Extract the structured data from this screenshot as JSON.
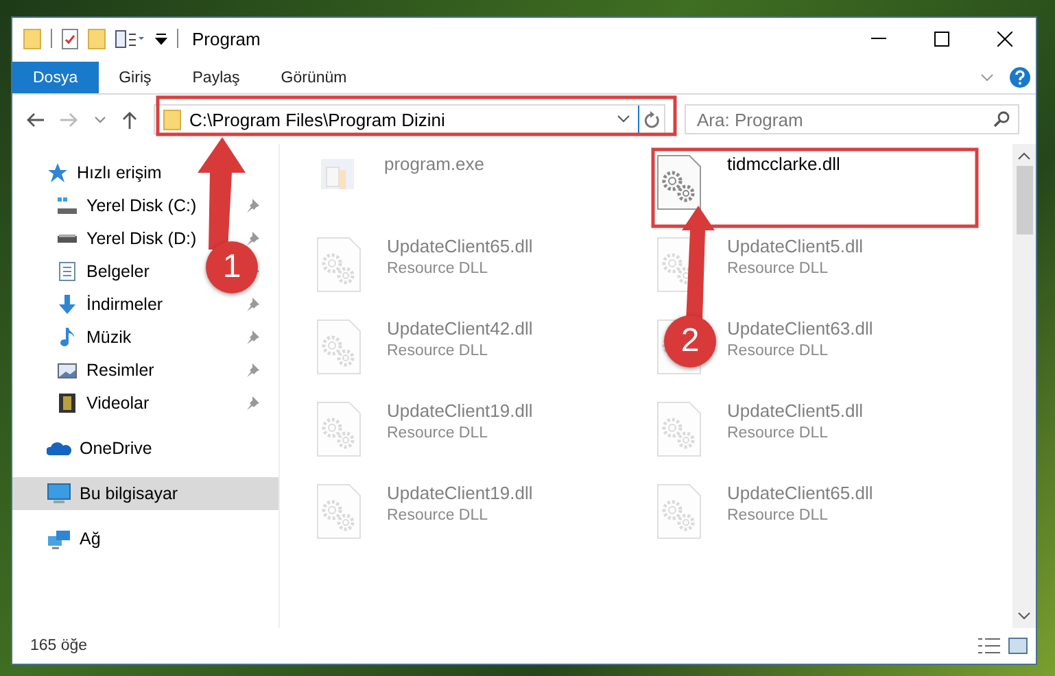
{
  "window": {
    "title": "Program"
  },
  "ribbon": {
    "tabs": [
      {
        "label": "Dosya",
        "selected": true
      },
      {
        "label": "Giriş",
        "selected": false
      },
      {
        "label": "Paylaş",
        "selected": false
      },
      {
        "label": "Görünüm",
        "selected": false
      }
    ]
  },
  "address_bar": {
    "path": "C:\\Program Files\\Program Dizini"
  },
  "search": {
    "placeholder": "Ara: Program"
  },
  "sidebar": {
    "items": [
      {
        "label": "Hızlı erişim",
        "kind": "star",
        "selected": false,
        "children": [
          {
            "label": "Yerel Disk (C:)",
            "kind": "drive-c",
            "pinned": true,
            "selected": false
          },
          {
            "label": "Yerel Disk (D:)",
            "kind": "drive",
            "pinned": true,
            "selected": false
          },
          {
            "label": "Belgeler",
            "kind": "document",
            "pinned": true,
            "selected": false
          },
          {
            "label": "İndirmeler",
            "kind": "download",
            "pinned": true,
            "selected": false
          },
          {
            "label": "Müzik",
            "kind": "music",
            "pinned": true,
            "selected": false
          },
          {
            "label": "Resimler",
            "kind": "picture",
            "pinned": true,
            "selected": false
          },
          {
            "label": "Videolar",
            "kind": "video",
            "pinned": true,
            "selected": false
          }
        ]
      },
      {
        "label": "OneDrive",
        "kind": "cloud",
        "selected": false
      },
      {
        "label": "Bu bilgisayar",
        "kind": "computer",
        "selected": true
      },
      {
        "label": "Ağ",
        "kind": "network",
        "selected": false
      }
    ]
  },
  "files": [
    {
      "name": "program.exe",
      "kind": "exe",
      "faded": true
    },
    {
      "name": "tidmcclarke.dll",
      "kind": "dll",
      "faded": false
    },
    {
      "name": "UpdateClient65.dll",
      "type": "Resource DLL",
      "kind": "dll",
      "faded": true
    },
    {
      "name": "UpdateClient5.dll",
      "type": "Resource DLL",
      "kind": "dll",
      "faded": true
    },
    {
      "name": "UpdateClient42.dll",
      "type": "Resource DLL",
      "kind": "dll",
      "faded": true
    },
    {
      "name": "UpdateClient63.dll",
      "type": "Resource DLL",
      "kind": "dll",
      "faded": true
    },
    {
      "name": "UpdateClient19.dll",
      "type": "Resource DLL",
      "kind": "dll",
      "faded": true
    },
    {
      "name": "UpdateClient5.dll",
      "type": "Resource DLL",
      "kind": "dll",
      "faded": true
    },
    {
      "name": "UpdateClient19.dll",
      "type": "Resource DLL",
      "kind": "dll",
      "faded": true
    },
    {
      "name": "UpdateClient65.dll",
      "type": "Resource DLL",
      "kind": "dll",
      "faded": true
    }
  ],
  "status_bar": {
    "count": "165 öğe"
  },
  "annotations": [
    {
      "label": "1"
    },
    {
      "label": "2"
    }
  ]
}
